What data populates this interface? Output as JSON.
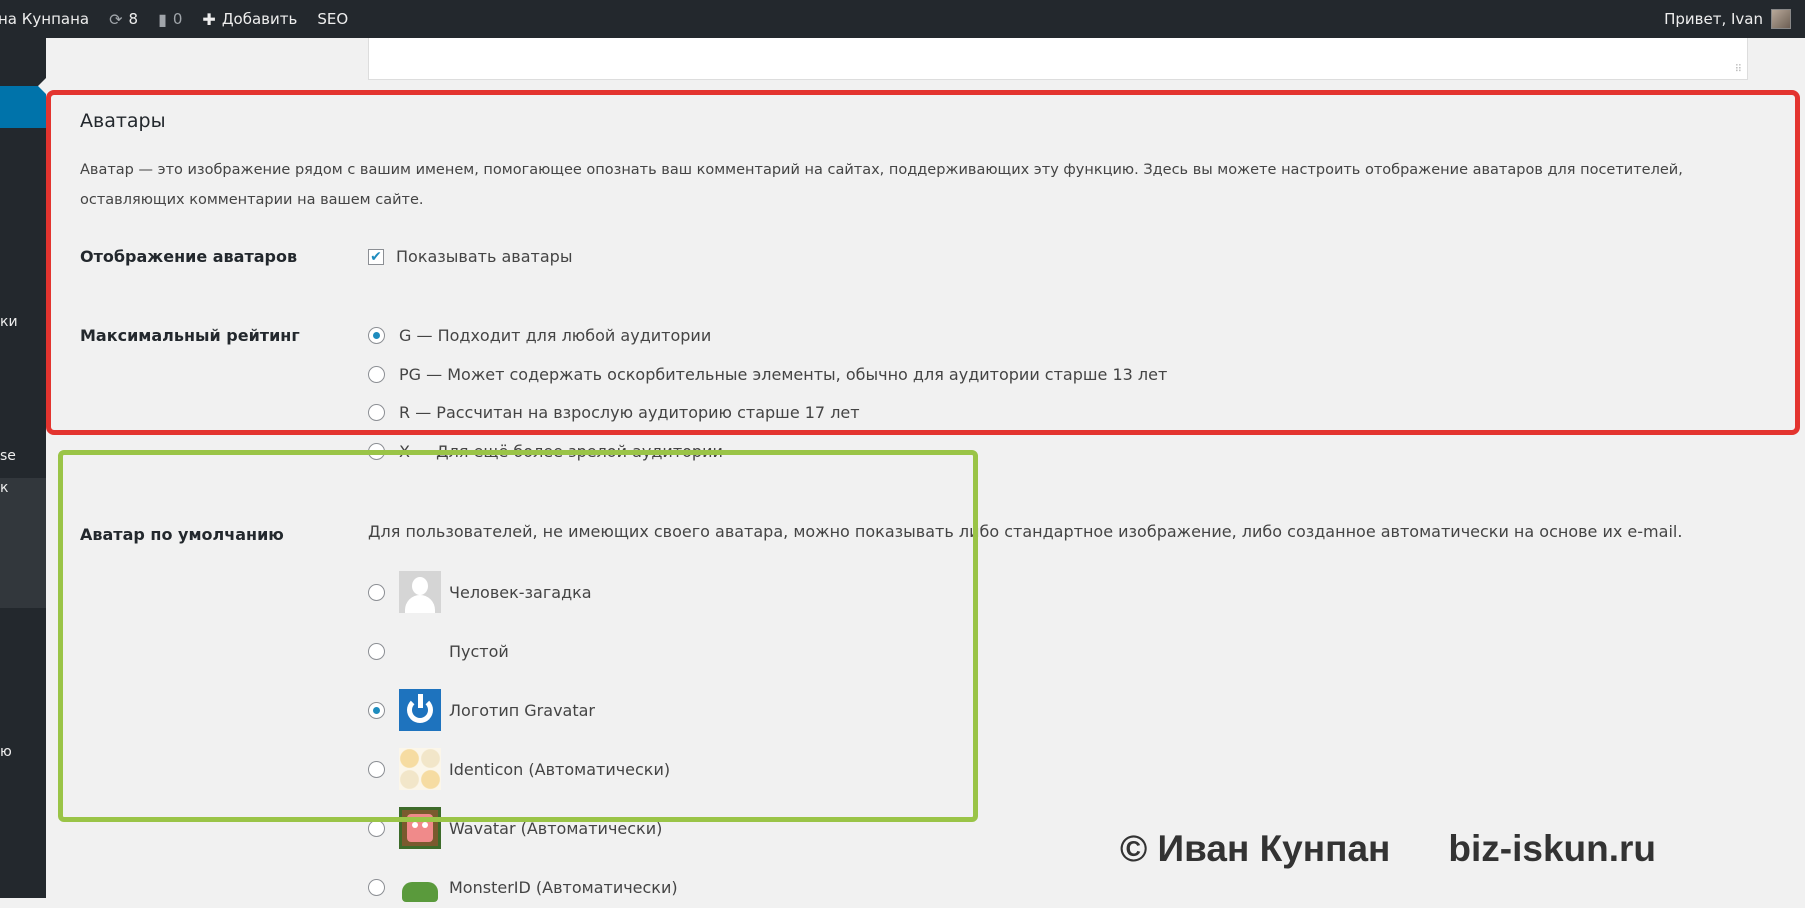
{
  "adminbar": {
    "site_name": "на Кунпана",
    "updates_count": "8",
    "comments_count": "0",
    "add_new_label": "Добавить",
    "seo_label": "SEO",
    "greeting": "Привет, Ivan"
  },
  "sidebar_fragments": {
    "item_a": "ки",
    "item_b": "se",
    "item_c": "к",
    "item_d": "ю"
  },
  "avatars": {
    "title": "Аватары",
    "description": "Аватар — это изображение рядом с вашим именем, помогающее опознать ваш комментарий на сайтах, поддерживающих эту функцию. Здесь вы можете настроить отображение аватаров для посетителей, оставляющих комментарии на вашем сайте.",
    "display": {
      "label": "Отображение аватаров",
      "checkbox_label": "Показывать аватары",
      "checked": true
    },
    "rating": {
      "label": "Максимальный рейтинг",
      "options": [
        {
          "label": "G — Подходит для любой аудитории",
          "selected": true
        },
        {
          "label": "PG — Может содержать оскорбительные элементы, обычно для аудитории старше 13 лет",
          "selected": false
        },
        {
          "label": "R — Рассчитан на взрослую аудиторию старше 17 лет",
          "selected": false
        },
        {
          "label": "X — Для ещё более зрелой аудитории",
          "selected": false
        }
      ]
    },
    "default_avatar": {
      "label": "Аватар по умолчанию",
      "description": "Для пользователей, не имеющих своего аватара, можно показывать либо стандартное изображение, либо созданное автоматически на основе их e-mail.",
      "options": [
        {
          "label": "Человек-загадка",
          "icon": "mystery-person-icon",
          "selected": false
        },
        {
          "label": "Пустой",
          "icon": "blank-icon",
          "selected": false
        },
        {
          "label": "Логотип Gravatar",
          "icon": "gravatar-logo-icon",
          "selected": true
        },
        {
          "label": "Identicon (Автоматически)",
          "icon": "identicon-icon",
          "selected": false
        },
        {
          "label": "Wavatar (Автоматически)",
          "icon": "wavatar-icon",
          "selected": false
        },
        {
          "label": "MonsterID (Автоматически)",
          "icon": "monsterid-icon",
          "selected": false
        }
      ]
    }
  },
  "watermark": {
    "author": "© Иван Кунпан",
    "site": "biz-iskun.ru"
  },
  "colors": {
    "adminbar_bg": "#23282d",
    "accent": "#0073aa",
    "highlight_red": "#e3342f",
    "highlight_green": "#9ac447"
  }
}
